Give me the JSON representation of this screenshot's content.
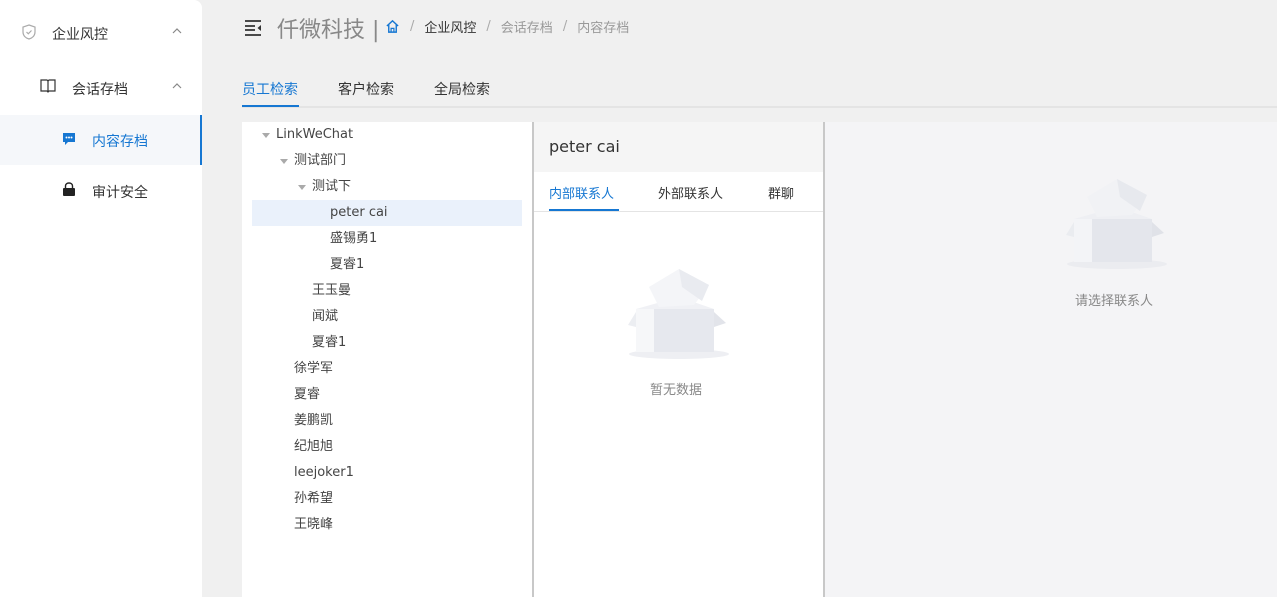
{
  "sidebar": {
    "items": [
      {
        "label": "企业风控",
        "icon": "shield-icon",
        "expanded": true
      },
      {
        "label": "会话存档",
        "icon": "book-icon",
        "expanded": true
      },
      {
        "label": "内容存档",
        "icon": "chat-icon",
        "active": true
      },
      {
        "label": "审计安全",
        "icon": "lock-icon"
      }
    ]
  },
  "header": {
    "brand": "仟微科技 |",
    "breadcrumb": [
      "企业风控",
      "会话存档",
      "内容存档"
    ],
    "separator": "/"
  },
  "tabs": [
    {
      "label": "员工检索",
      "active": true
    },
    {
      "label": "客户检索"
    },
    {
      "label": "全局检索"
    }
  ],
  "tree": [
    {
      "label": "LinkWeChat",
      "level": 0,
      "expanded": true
    },
    {
      "label": "测试部门",
      "level": 1,
      "expanded": true
    },
    {
      "label": "测试下",
      "level": 2,
      "expanded": true
    },
    {
      "label": "peter cai",
      "level": 3,
      "selected": true
    },
    {
      "label": "盛锡勇1",
      "level": 3
    },
    {
      "label": "夏睿1",
      "level": 3
    },
    {
      "label": "王玉曼",
      "level": 2
    },
    {
      "label": "闻斌",
      "level": 2
    },
    {
      "label": "夏睿1",
      "level": 2
    },
    {
      "label": "徐学军",
      "level": 1
    },
    {
      "label": "夏睿",
      "level": 1
    },
    {
      "label": "姜鹏凯",
      "level": 1
    },
    {
      "label": "纪旭旭",
      "level": 1
    },
    {
      "label": "leejoker1",
      "level": 1
    },
    {
      "label": "孙希望",
      "level": 1
    },
    {
      "label": "王晓峰",
      "level": 1
    }
  ],
  "contact_panel": {
    "name": "peter cai",
    "tabs": [
      {
        "label": "内部联系人",
        "active": true
      },
      {
        "label": "外部联系人"
      },
      {
        "label": "群聊"
      }
    ],
    "empty_text": "暂无数据"
  },
  "chat_panel": {
    "empty_text": "请选择联系人"
  },
  "colors": {
    "accent": "#1677d2",
    "selected_bg": "#eaf1fb",
    "page_bg": "#f0f0f0"
  }
}
